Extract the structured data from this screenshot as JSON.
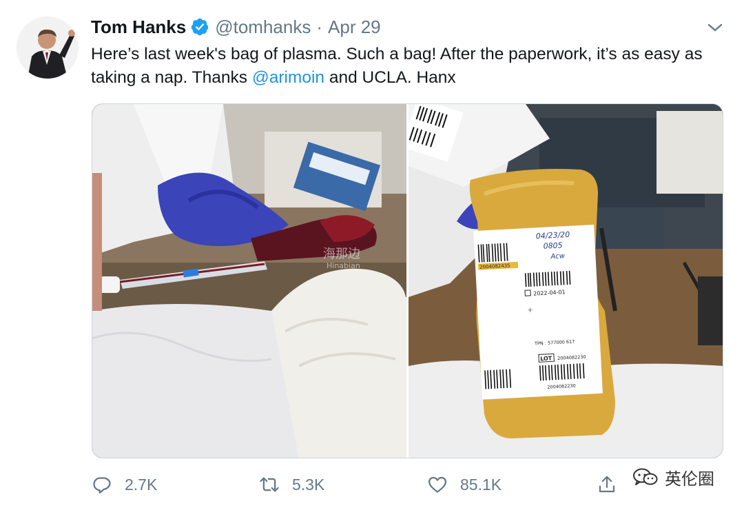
{
  "author": {
    "name": "Tom Hanks",
    "handle": "@tomhanks",
    "separator": "·",
    "date": "Apr 29",
    "verified": true
  },
  "tweet": {
    "text_before": "Here’s last week's bag of plasma. Such a bag!  After the paperwork, it’s as easy as taking a nap.  Thanks ",
    "mention": "@arimoin",
    "text_after": " and UCLA. Hanx"
  },
  "media": {
    "left_photo": {
      "description_icon": "image-icon",
      "watermark_cn": "海那边",
      "watermark_en": "Hinabian"
    },
    "right_photo": {
      "description_icon": "image-icon",
      "label_handwritten_date": "04/23/20",
      "label_handwritten_time": "0805",
      "label_handwritten_initials": "Acw",
      "label_barcode_top": "2004082435",
      "label_expiry": "2022-04-01",
      "label_tpn": "TPN : 577000 617",
      "label_lot_tag": "LOT",
      "label_lot_value": "2004082230",
      "label_barcode_bottom": "2004082230"
    }
  },
  "actions": {
    "replies": "2.7K",
    "retweets": "5.3K",
    "likes": "85.1K"
  },
  "watermark": {
    "text": "英伦圈"
  },
  "colors": {
    "link": "#1b95e0",
    "verified": "#1da1f2",
    "secondary_text": "#657786",
    "icon": "#657786"
  }
}
